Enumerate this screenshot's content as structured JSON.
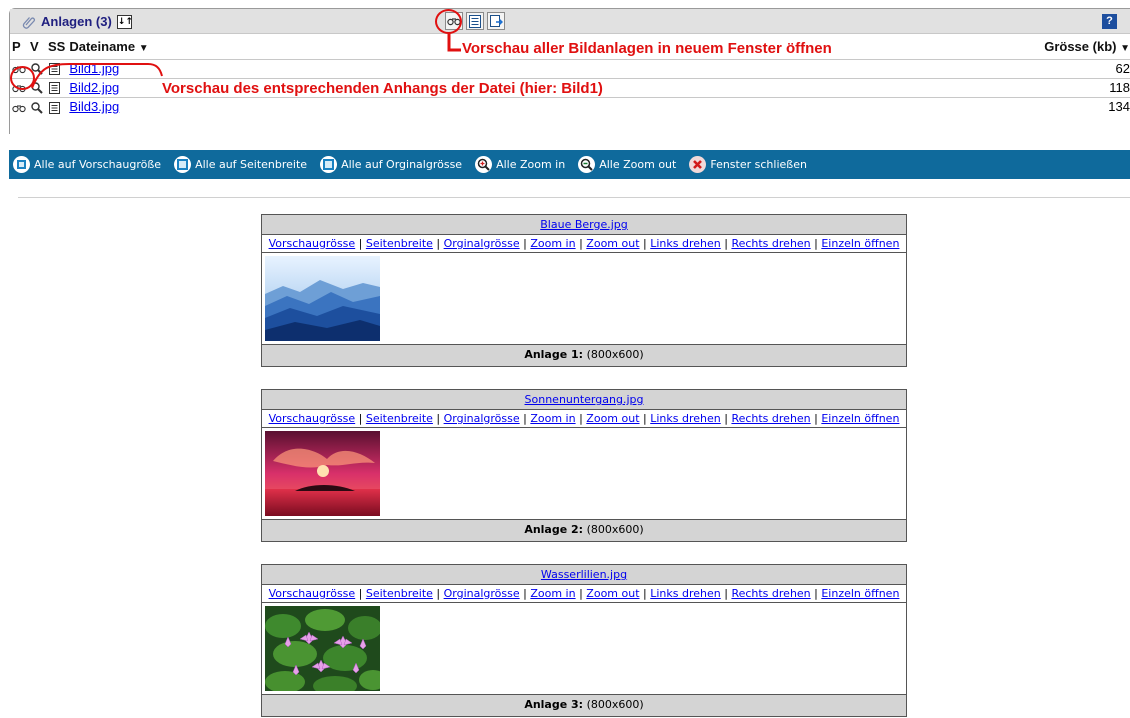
{
  "attachments": {
    "title": "Anlagen (3)",
    "sort_icon": "sort-toggle-icon",
    "header_tools": [
      "binoculars-icon",
      "list-view-icon",
      "export-icon"
    ],
    "help_label": "?",
    "columns": {
      "p": "P",
      "v": "V",
      "ss": "SS",
      "filename": "Dateiname",
      "size": "Grösse (kb)"
    },
    "rows": [
      {
        "name": "Bild1.jpg",
        "size": "62"
      },
      {
        "name": "Bild2.jpg",
        "size": "118"
      },
      {
        "name": "Bild3.jpg",
        "size": "134"
      }
    ]
  },
  "annotations": {
    "preview_all": "Vorschau aller Bildanlagen in neuem Fenster öffnen",
    "preview_single": "Vorschau des entsprechenden Anhangs der Datei (hier: Bild1)"
  },
  "toolbar": {
    "items": [
      {
        "label": "Alle auf Vorschaugröße",
        "icon": "preview-size-icon"
      },
      {
        "label": "Alle auf Seitenbreite",
        "icon": "page-width-icon"
      },
      {
        "label": "Alle auf Orginalgrösse",
        "icon": "original-size-icon"
      },
      {
        "label": "Alle Zoom in",
        "icon": "zoom-in-icon"
      },
      {
        "label": "Alle Zoom out",
        "icon": "zoom-out-icon"
      },
      {
        "label": "Fenster schließen",
        "icon": "close-window-icon"
      }
    ]
  },
  "links": [
    "Vorschaugrösse",
    "Seitenbreite",
    "Orginalgrösse",
    "Zoom in",
    "Zoom out",
    "Links drehen",
    "Rechts drehen",
    "Einzeln öffnen"
  ],
  "cards": [
    {
      "title": "Blaue Berge.jpg",
      "foot_label": "Anlage 1:",
      "foot_dims": "(800x600)"
    },
    {
      "title": "Sonnenuntergang.jpg",
      "foot_label": "Anlage 2:",
      "foot_dims": "(800x600)"
    },
    {
      "title": "Wasserlilien.jpg",
      "foot_label": "Anlage 3:",
      "foot_dims": "(800x600)"
    }
  ]
}
